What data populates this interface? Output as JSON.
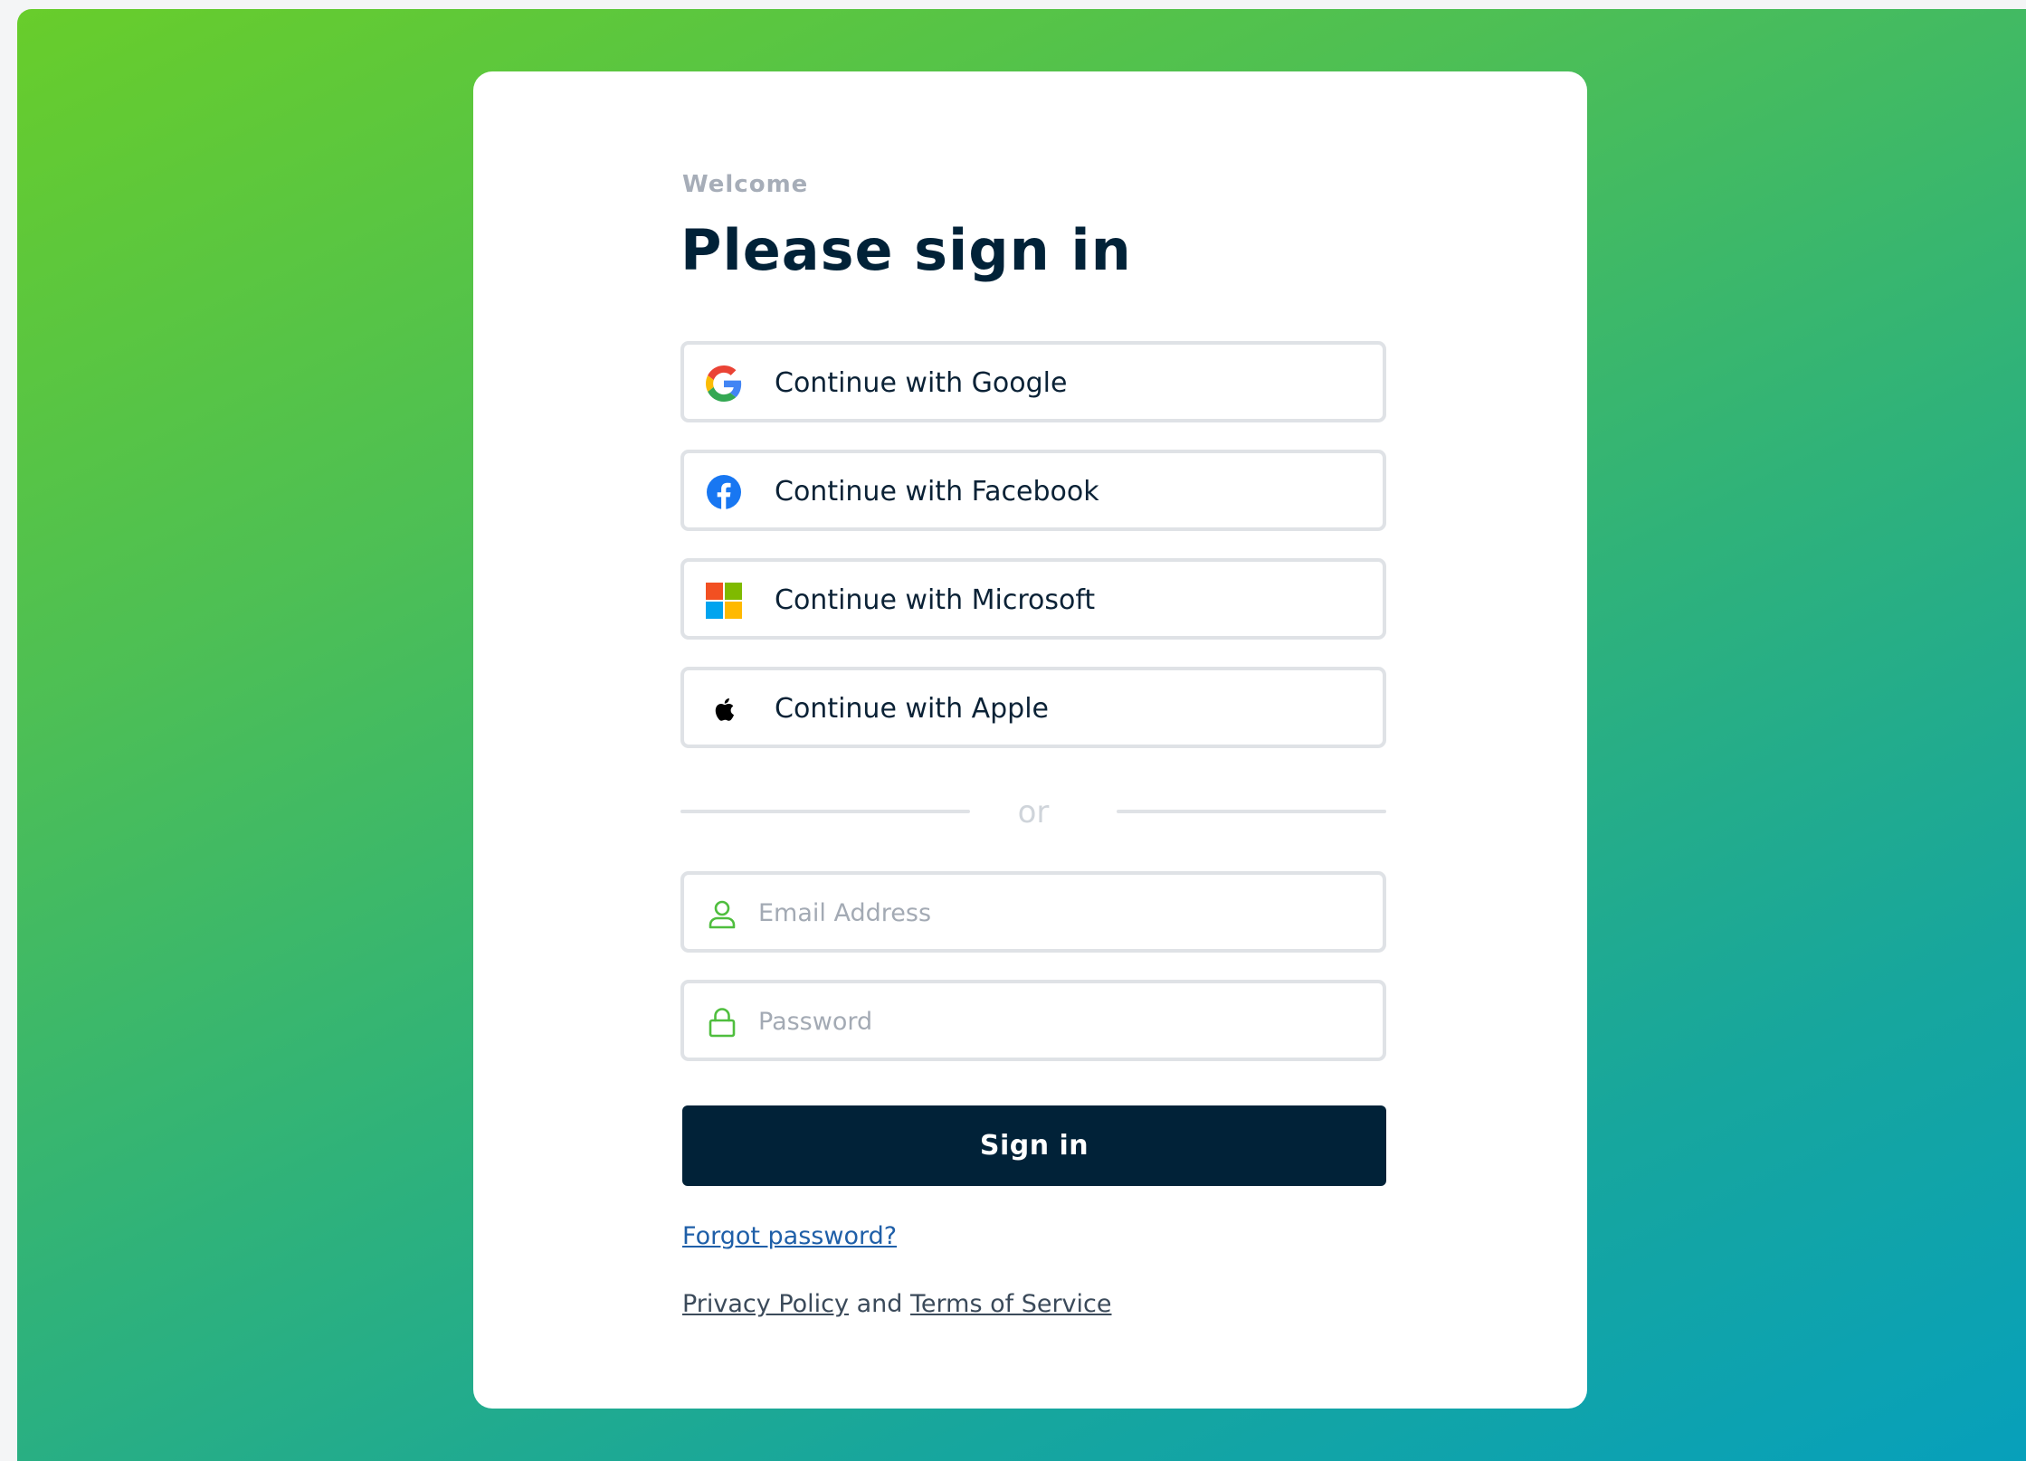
{
  "header": {
    "eyebrow": "Welcome",
    "title": "Please sign in"
  },
  "social": {
    "google": {
      "label": "Continue with Google",
      "icon": "google-icon"
    },
    "facebook": {
      "label": "Continue with Facebook",
      "icon": "facebook-icon"
    },
    "microsoft": {
      "label": "Continue with Microsoft",
      "icon": "microsoft-icon"
    },
    "apple": {
      "label": "Continue with Apple",
      "icon": "apple-icon"
    }
  },
  "divider": {
    "label": "or"
  },
  "form": {
    "email": {
      "value": "",
      "placeholder": "Email Address",
      "icon": "user-icon"
    },
    "password": {
      "value": "",
      "placeholder": "Password",
      "icon": "lock-icon"
    },
    "submit_label": "Sign in"
  },
  "links": {
    "forgot": "Forgot password?",
    "privacy": "Privacy Policy",
    "conjunction": "and",
    "terms": "Terms of Service"
  },
  "colors": {
    "primary": "#012238",
    "accent_green": "#4fbe3e",
    "gradient_start": "#68cd2b",
    "gradient_end": "#07a0bb",
    "border": "#dfe2e6",
    "muted": "#a6adb8"
  }
}
